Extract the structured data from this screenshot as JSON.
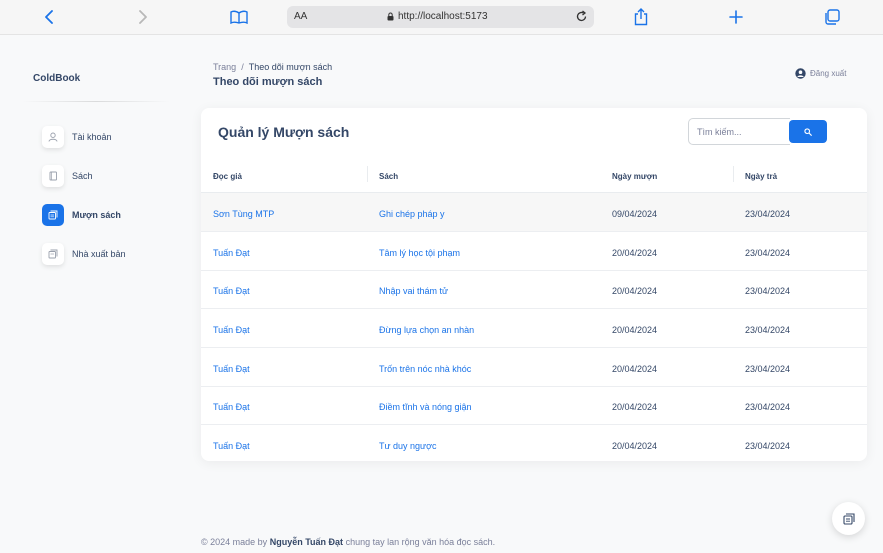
{
  "browser": {
    "aa_label": "AA",
    "url": "http://localhost:5173"
  },
  "sidebar": {
    "brand": "ColdBook",
    "items": [
      {
        "label": "Tài khoản",
        "icon": "user-icon",
        "active": false
      },
      {
        "label": "Sách",
        "icon": "book-icon",
        "active": false
      },
      {
        "label": "Mượn sách",
        "icon": "borrow-icon",
        "active": true
      },
      {
        "label": "Nhà xuất bản",
        "icon": "publisher-icon",
        "active": false
      }
    ]
  },
  "header": {
    "breadcrumb_root": "Trang",
    "breadcrumb_sep": "/",
    "breadcrumb_current": "Theo dõi mượn sách",
    "title": "Theo dõi mượn sách",
    "logout_label": "Đăng xuất"
  },
  "card": {
    "title": "Quản lý Mượn sách",
    "search_placeholder": "Tìm kiếm...",
    "columns": [
      "Đọc giả",
      "Sách",
      "Ngày mượn",
      "Ngày trả"
    ],
    "rows": [
      {
        "reader": "Sơn Tùng MTP",
        "book": "Ghi chép pháp y",
        "borrow_date": "09/04/2024",
        "return_date": "23/04/2024"
      },
      {
        "reader": "Tuấn Đạt",
        "book": "Tâm lý học tội phạm",
        "borrow_date": "20/04/2024",
        "return_date": "23/04/2024"
      },
      {
        "reader": "Tuấn Đạt",
        "book": "Nhập vai thám tử",
        "borrow_date": "20/04/2024",
        "return_date": "23/04/2024"
      },
      {
        "reader": "Tuấn Đạt",
        "book": "Đừng lựa chọn an nhàn",
        "borrow_date": "20/04/2024",
        "return_date": "23/04/2024"
      },
      {
        "reader": "Tuấn Đạt",
        "book": "Trốn trên nóc nhà khóc",
        "borrow_date": "20/04/2024",
        "return_date": "23/04/2024"
      },
      {
        "reader": "Tuấn Đạt",
        "book": "Điềm tĩnh và nóng giận",
        "borrow_date": "20/04/2024",
        "return_date": "23/04/2024"
      },
      {
        "reader": "Tuấn Đạt",
        "book": "Tư duy ngược",
        "borrow_date": "20/04/2024",
        "return_date": "23/04/2024"
      }
    ]
  },
  "footer": {
    "prefix": "© 2024 made by",
    "author": "Nguyễn Tuấn Đạt",
    "suffix": "chung tay lan rộng văn hóa đọc sách."
  },
  "colors": {
    "accent": "#1a73e8",
    "text": "#344767",
    "muted": "#7b809a"
  }
}
